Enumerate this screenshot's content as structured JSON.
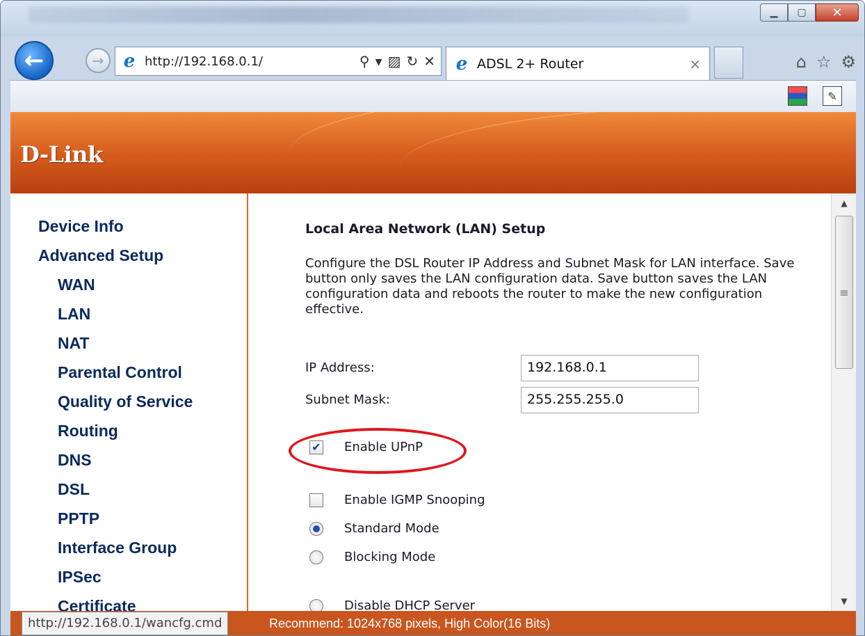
{
  "browser": {
    "url": "http://192.168.0.1/",
    "tab_title": "ADSL 2+ Router",
    "status_url": "http://192.168.0.1/wancfg.cmd"
  },
  "brand": {
    "logo": "D-Link"
  },
  "sidebar": {
    "items": [
      {
        "label": "Device Info",
        "sub": false
      },
      {
        "label": "Advanced Setup",
        "sub": false
      },
      {
        "label": "WAN",
        "sub": true
      },
      {
        "label": "LAN",
        "sub": true
      },
      {
        "label": "NAT",
        "sub": true
      },
      {
        "label": "Parental Control",
        "sub": true
      },
      {
        "label": "Quality of Service",
        "sub": true
      },
      {
        "label": "Routing",
        "sub": true
      },
      {
        "label": "DNS",
        "sub": true
      },
      {
        "label": "DSL",
        "sub": true
      },
      {
        "label": "PPTP",
        "sub": true
      },
      {
        "label": "Interface Group",
        "sub": true
      },
      {
        "label": "IPSec",
        "sub": true
      },
      {
        "label": "Certificate",
        "sub": true
      }
    ]
  },
  "main": {
    "title": "Local Area Network (LAN) Setup",
    "description": "Configure the DSL Router IP Address and Subnet Mask for LAN interface.  Save button only saves the LAN configuration data.  Save button saves the LAN configuration data and reboots the router to make the new configuration effective.",
    "ip_label": "IP Address:",
    "ip_value": "192.168.0.1",
    "mask_label": "Subnet Mask:",
    "mask_value": "255.255.255.0",
    "upnp_label": "Enable UPnP",
    "upnp_checked": true,
    "igmp_label": "Enable IGMP Snooping",
    "igmp_checked": false,
    "standard_label": "Standard Mode",
    "blocking_label": "Blocking Mode",
    "dhcp_disable_label": "Disable DHCP Server"
  },
  "footer": {
    "text": "Recommend: 1024x768 pixels, High Color(16 Bits)"
  },
  "colors": {
    "banner": "#d45a1c",
    "footer": "#c8561e",
    "menu_text": "#0a2a5c",
    "annotation": "#e0161d"
  },
  "icons": [
    "back-icon",
    "forward-icon",
    "ie-icon",
    "search-icon",
    "refresh-icon",
    "stop-icon",
    "home-icon",
    "favorites-icon",
    "gear-icon",
    "feeds-icon",
    "compat-icon"
  ]
}
